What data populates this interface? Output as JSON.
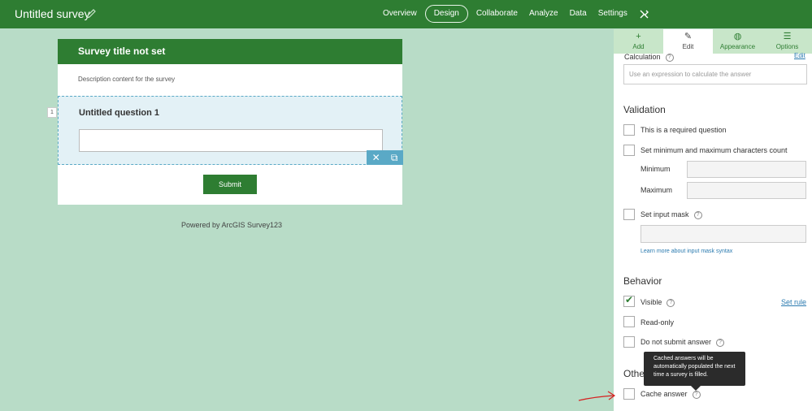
{
  "header": {
    "title": "Untitled survey",
    "nav": [
      "Overview",
      "Design",
      "Collaborate",
      "Analyze",
      "Data",
      "Settings"
    ],
    "active": "Design"
  },
  "survey": {
    "title": "Survey title not set",
    "description": "Description content for the survey",
    "question_number": "1",
    "question_title": "Untitled question 1",
    "submit_label": "Submit",
    "powered_by": "Powered by ArcGIS Survey123"
  },
  "panel": {
    "tabs": [
      {
        "label": "Add",
        "icon": "plus-icon"
      },
      {
        "label": "Edit",
        "icon": "pencil-icon"
      },
      {
        "label": "Appearance",
        "icon": "palette-icon"
      },
      {
        "label": "Options",
        "icon": "sliders-icon"
      }
    ],
    "calculation_label": "Calculation",
    "calculation_edit": "Edit",
    "calculation_placeholder": "Use an expression to calculate the answer",
    "validation_title": "Validation",
    "required_label": "This is a required question",
    "minmax_label": "Set minimum and maximum characters count",
    "minimum_label": "Minimum",
    "maximum_label": "Maximum",
    "input_mask_label": "Set input mask",
    "input_mask_link": "Learn more about input mask syntax",
    "behavior_title": "Behavior",
    "visible_label": "Visible",
    "set_rule": "Set rule",
    "readonly_label": "Read-only",
    "do_not_submit_label": "Do not submit answer",
    "other_title": "Other",
    "cache_answer_label": "Cache answer",
    "tooltip": "Cached answers will be automatically populated the next time a survey is filled."
  },
  "colors": {
    "brand_green": "#2e7d32",
    "canvas": "#b8dcc7",
    "selection_blue": "#5aa9c6"
  }
}
